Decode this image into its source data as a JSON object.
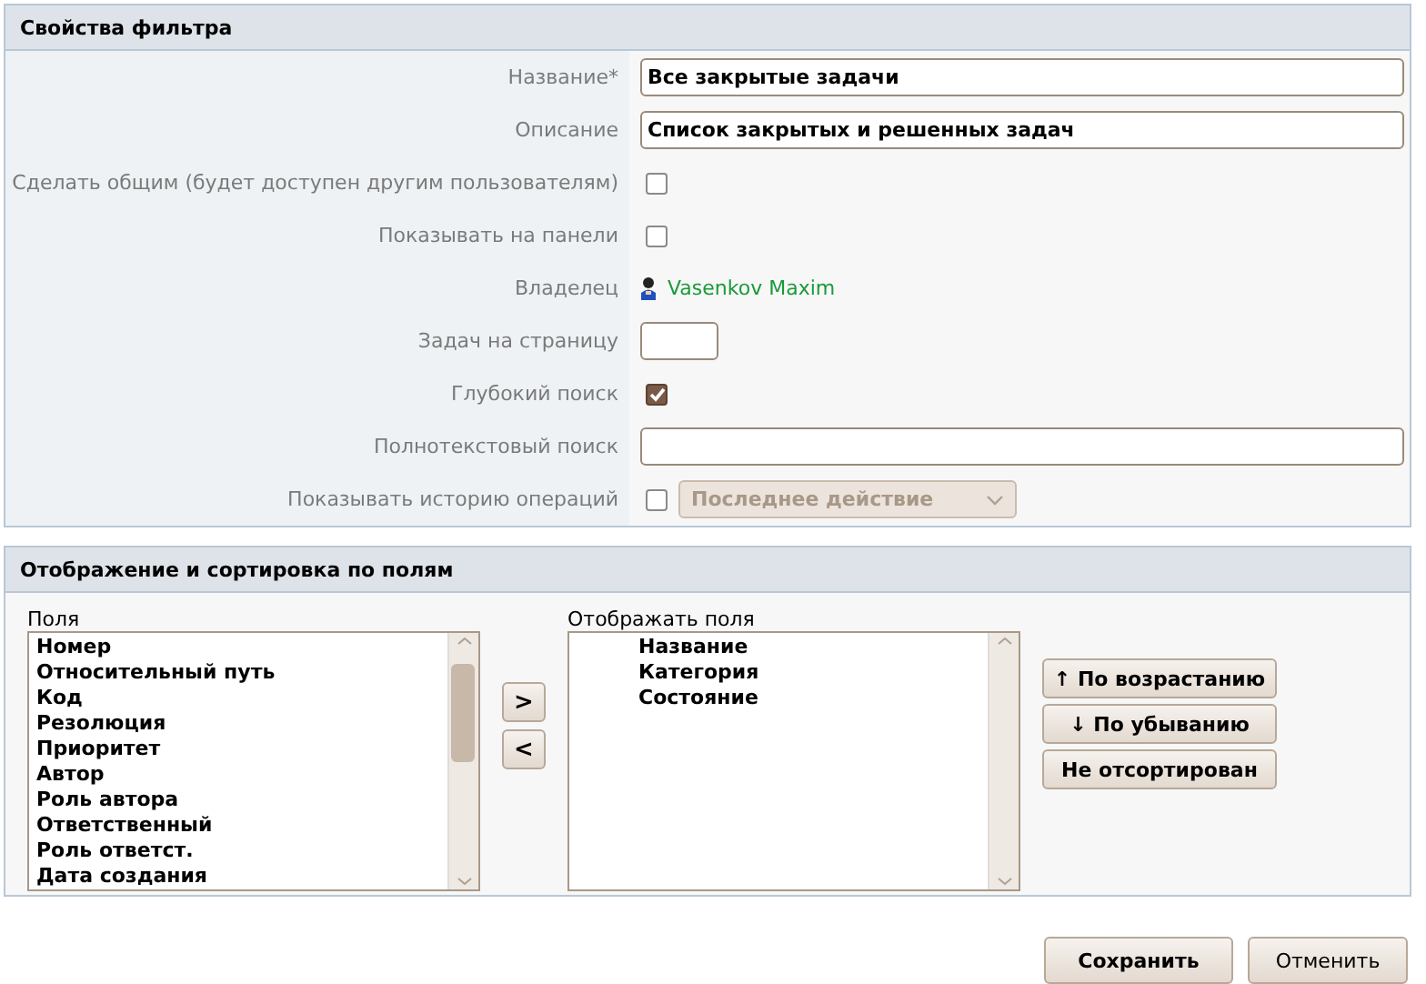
{
  "properties_panel": {
    "title": "Свойства фильтра",
    "rows": [
      {
        "kind": "input",
        "label": "Название*",
        "value": "Все закрытые задачи"
      },
      {
        "kind": "input",
        "label": "Описание",
        "value": "Список закрытых и решенных задач"
      },
      {
        "kind": "checkbox",
        "label": "Сделать общим (будет доступен другим пользователям)",
        "checked": false
      },
      {
        "kind": "checkbox",
        "label": "Показывать на панели",
        "checked": false
      },
      {
        "kind": "user",
        "label": "Владелец",
        "value": "Vasenkov Maxim"
      },
      {
        "kind": "short-input",
        "label": "Задач на страницу"
      },
      {
        "kind": "checkbox",
        "label": "Глубокий поиск",
        "checked": true
      },
      {
        "kind": "input",
        "label": "Полнотекстовый поиск"
      },
      {
        "kind": "checkbox-select",
        "label": "Показывать историю операций",
        "checked": false,
        "select": {
          "value": "Последнее действие",
          "disabled": true
        }
      }
    ]
  },
  "fields_panel": {
    "title": "Отображение и сортировка по полям",
    "available": {
      "label": "Поля",
      "items": [
        "Номер",
        "Относительный путь",
        "Код",
        "Резолюция",
        "Приоритет",
        "Автор",
        "Роль автора",
        "Ответственный",
        "Роль ответст.",
        "Дата создания"
      ]
    },
    "move_buttons": [
      ">",
      "<"
    ],
    "shown": {
      "label": "Отображать поля",
      "items": [
        "Название",
        "Категория",
        "Состояние"
      ]
    },
    "sort_buttons": [
      "↑ По возрастанию",
      "↓  По убыванию",
      "Не отсортирован"
    ]
  },
  "buttons": [
    {
      "label": "Сохранить",
      "primary": true
    },
    {
      "label": "Отменить",
      "primary": false
    }
  ]
}
